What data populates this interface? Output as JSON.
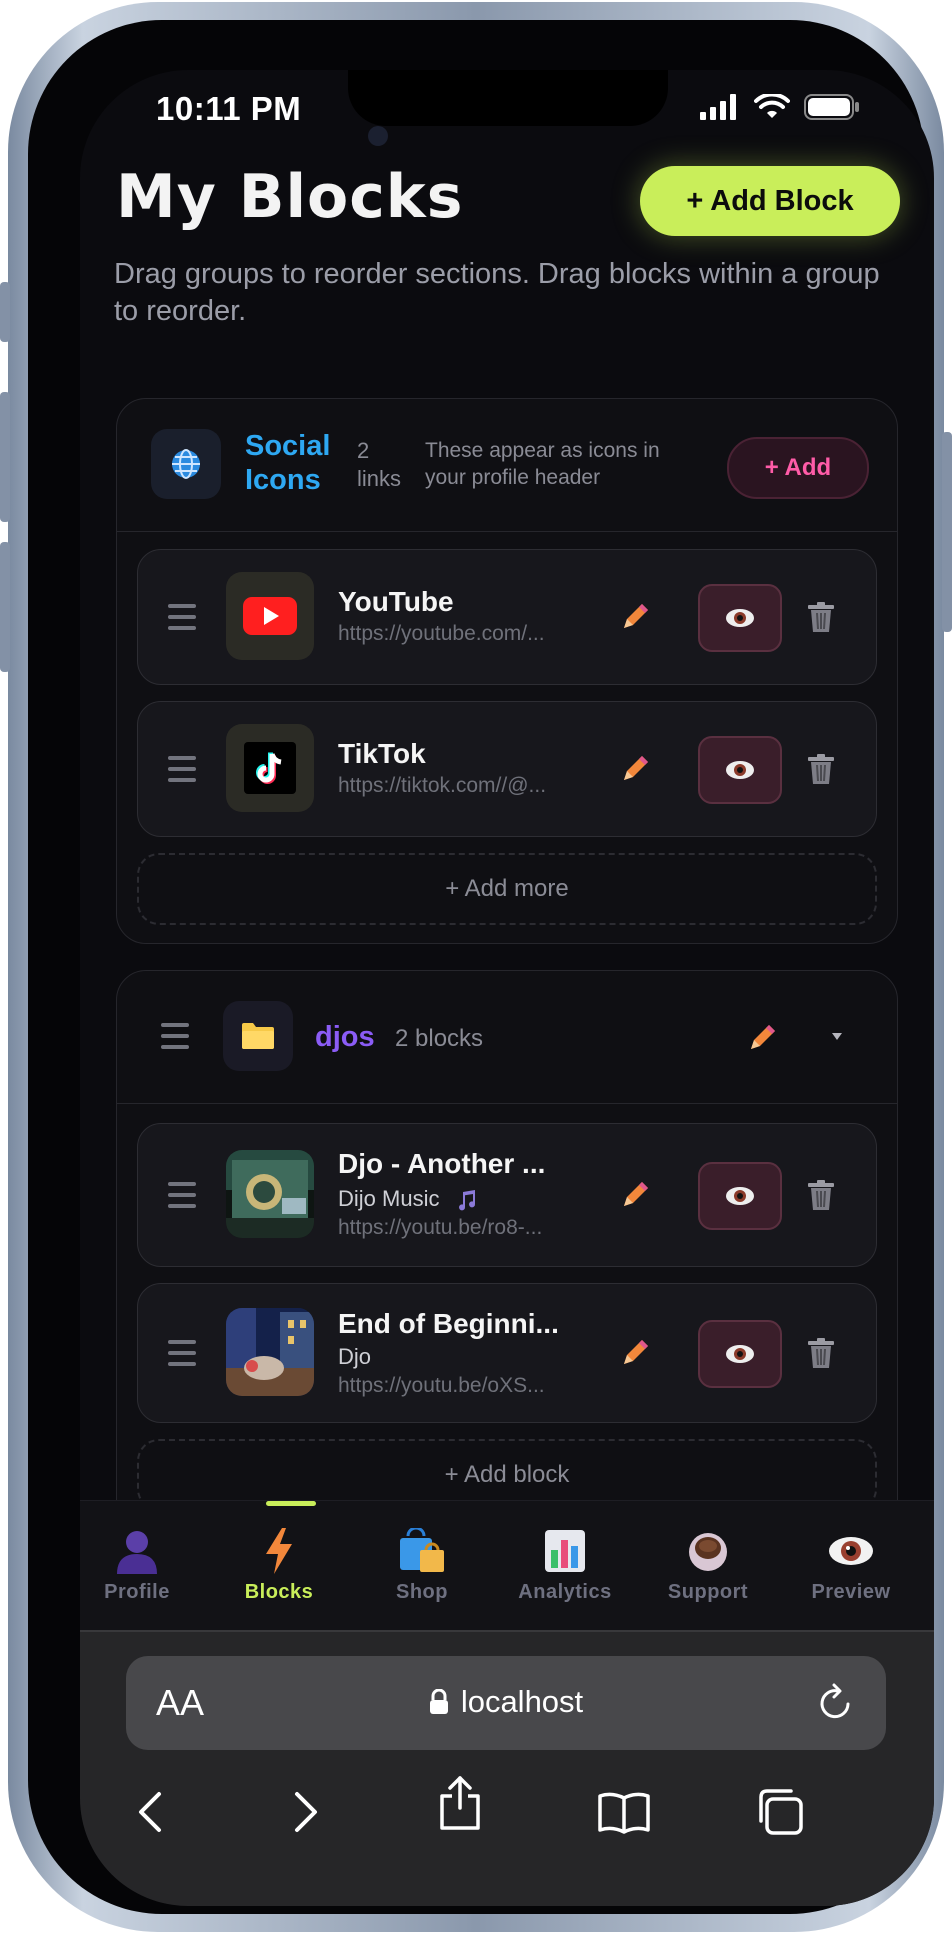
{
  "status": {
    "time": "10:11 PM"
  },
  "header": {
    "title": "My Blocks",
    "add_button": "+ Add Block",
    "subtitle": "Drag groups to reorder sections. Drag blocks within a group to reorder."
  },
  "social_group": {
    "title_line1": "Social",
    "title_line2": "Icons",
    "count_line1": "2",
    "count_line2": "links",
    "hint": "These appear as icons in your profile header",
    "add_label": "+ Add",
    "items": [
      {
        "title": "YouTube",
        "url": "https://youtube.com/...",
        "icon": "youtube-icon"
      },
      {
        "title": "TikTok",
        "url": "https://tiktok.com//@...",
        "icon": "tiktok-icon"
      }
    ],
    "add_more": "+ Add more"
  },
  "djos_group": {
    "title": "djos",
    "count": "2 blocks",
    "items": [
      {
        "title": "Djo - Another ...",
        "subtitle": "Dijo Music",
        "url": "https://youtu.be/ro8-..."
      },
      {
        "title": "End of Beginni...",
        "subtitle": "Djo",
        "url": "https://youtu.be/oXS..."
      }
    ],
    "add_block": "+ Add block"
  },
  "tabs": [
    {
      "label": "Profile",
      "icon": "person-icon"
    },
    {
      "label": "Blocks",
      "icon": "lightning-icon",
      "active": true
    },
    {
      "label": "Shop",
      "icon": "shopping-bag-icon"
    },
    {
      "label": "Analytics",
      "icon": "chart-icon"
    },
    {
      "label": "Support",
      "icon": "coffee-icon"
    },
    {
      "label": "Preview",
      "icon": "eye-icon"
    }
  ],
  "browser": {
    "aa_label": "AA",
    "url": "localhost"
  },
  "colors": {
    "accent": "#c9ee5a",
    "social_title": "#2ea8f2",
    "group_title": "#8b5cf6",
    "pink": "#ff5ca8"
  }
}
